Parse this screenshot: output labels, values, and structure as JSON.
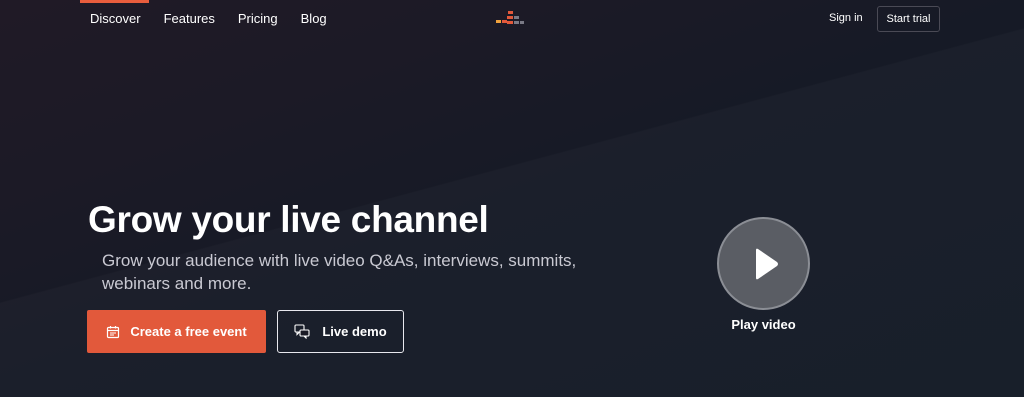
{
  "nav": {
    "links": [
      "Discover",
      "Features",
      "Pricing",
      "Blog"
    ],
    "active_index": 0,
    "sign_in": "Sign in",
    "start_trial": "Start trial"
  },
  "hero": {
    "title": "Grow your live channel",
    "subtitle": "Grow your audience with live video Q&As, interviews, summits, webinars and more.",
    "primary_button": "Create a free event",
    "secondary_button": "Live demo",
    "play_label": "Play video"
  },
  "colors": {
    "accent": "#e2593b",
    "logo_orange": "#f07a3d",
    "logo_red": "#e2593b",
    "logo_gray": "#7a7a86"
  },
  "icons": {
    "primary_button_icon": "calendar-icon",
    "secondary_button_icon": "chat-bubbles-icon",
    "play_icon": "play-icon"
  }
}
